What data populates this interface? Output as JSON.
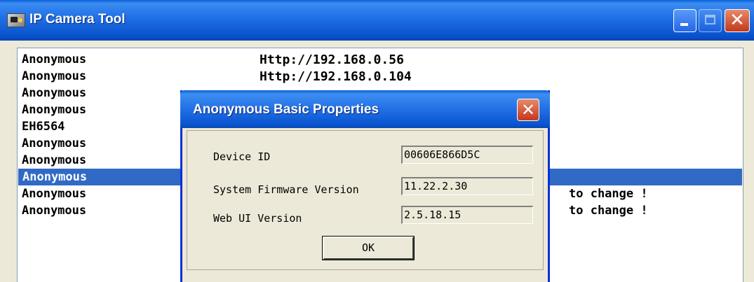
{
  "window": {
    "title": "IP Camera Tool",
    "minimize_label": "",
    "close_symbol": "✕"
  },
  "list": {
    "rows": [
      {
        "name": "Anonymous",
        "url": "Http://192.168.0.56",
        "extra": "",
        "selected": false
      },
      {
        "name": "Anonymous",
        "url": "Http://192.168.0.104",
        "extra": "",
        "selected": false
      },
      {
        "name": "Anonymous",
        "url": "",
        "extra": "",
        "selected": false
      },
      {
        "name": "Anonymous",
        "url": "",
        "extra": "",
        "selected": false
      },
      {
        "name": "EH6564",
        "url": "",
        "extra": "",
        "selected": false
      },
      {
        "name": "Anonymous",
        "url": "",
        "extra": "",
        "selected": false
      },
      {
        "name": "Anonymous",
        "url": "",
        "extra": "",
        "selected": false
      },
      {
        "name": "Anonymous",
        "url": "",
        "extra": "",
        "selected": true
      },
      {
        "name": "Anonymous",
        "url": "",
        "extra": "to change !",
        "selected": false
      },
      {
        "name": "Anonymous",
        "url": "",
        "extra": "to change !",
        "selected": false
      }
    ]
  },
  "dialog": {
    "title": "Anonymous Basic Properties",
    "close_symbol": "✕",
    "fields": [
      {
        "label": "Device ID",
        "value": "00606E866D5C"
      },
      {
        "label": "System Firmware Version",
        "value": "11.22.2.30"
      },
      {
        "label": "Web UI Version",
        "value": "2.5.18.15"
      }
    ],
    "ok_label": "OK"
  },
  "colors": {
    "titlebar_blue": "#1f6fe6",
    "selection_blue": "#316ac5",
    "close_red": "#c2381c",
    "dialog_bg": "#ece9d8"
  },
  "icons": [
    "app-icon",
    "minimize-icon",
    "maximize-icon",
    "close-icon"
  ]
}
